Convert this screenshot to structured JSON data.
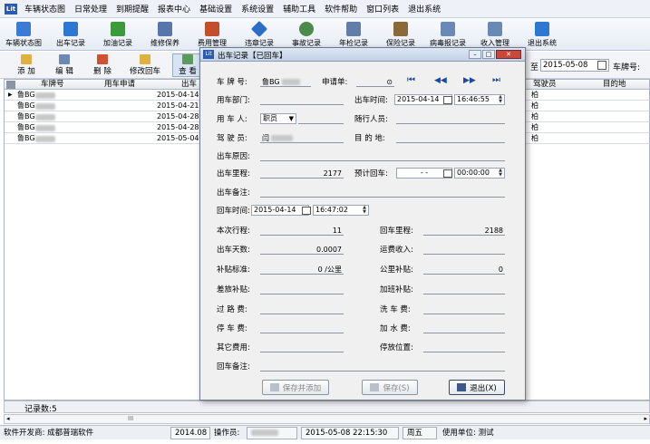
{
  "menubar": {
    "logo": "Lit",
    "items": [
      "车辆状态图",
      "日常处理",
      "到期提醒",
      "报表中心",
      "基础设置",
      "系统设置",
      "辅助工具",
      "软件帮助",
      "窗口列表",
      "退出系统"
    ]
  },
  "toolbar": {
    "buttons": [
      {
        "label": "车辆状态图",
        "icon": "car-status-icon",
        "color": "#3a7bd5"
      },
      {
        "label": "出车记录",
        "icon": "dispatch-icon",
        "color": "#2f78d2"
      },
      {
        "label": "加油记录",
        "icon": "fuel-icon",
        "color": "#3b9a3b"
      },
      {
        "label": "维修保养",
        "icon": "repair-icon",
        "color": "#5577aa"
      },
      {
        "label": "费用管理",
        "icon": "expense-icon",
        "color": "#c44d2a"
      },
      {
        "label": "违章记录",
        "icon": "violation-icon",
        "color": "#2a6fc4"
      },
      {
        "label": "事故记录",
        "icon": "accident-icon",
        "color": "#4a8a4a"
      },
      {
        "label": "年检记录",
        "icon": "inspection-icon",
        "color": "#5f7ea8"
      },
      {
        "label": "保险记录",
        "icon": "insurance-icon",
        "color": "#8a6a3a"
      },
      {
        "label": "病毒报记录",
        "icon": "report-icon",
        "color": "#6a8ab5"
      },
      {
        "label": "收入管理",
        "icon": "income-icon",
        "color": "#6a8ab5"
      },
      {
        "label": "退出系统",
        "icon": "exit-icon",
        "color": "#2f78d2"
      }
    ]
  },
  "toolbar2": {
    "add": "添 加",
    "edit": "编 辑",
    "delete": "删 除",
    "modify_return": "修改回车",
    "view": "查 看",
    "date_prefix": "至",
    "date_value": "2015-05-08",
    "plate_label": "车牌号:"
  },
  "grid": {
    "headers": {
      "plate": "车牌号",
      "request": "用车申请",
      "dispatch": "出车",
      "driver": "驾驶员",
      "destination": "目的地"
    },
    "rows": [
      {
        "plate": "鲁BG",
        "date": "2015-04-14",
        "driver": "柏"
      },
      {
        "plate": "鲁BG",
        "date": "2015-04-21",
        "driver": "柏"
      },
      {
        "plate": "鲁BG",
        "date": "2015-04-28",
        "driver": "柏"
      },
      {
        "plate": "鲁BG",
        "date": "2015-04-28",
        "driver": "柏"
      },
      {
        "plate": "鲁BG",
        "date": "2015-05-04",
        "driver": "柏"
      }
    ],
    "record_count": "记录数:5",
    "scroll_mark": "III"
  },
  "dialog": {
    "title": "出车记录【已回车】",
    "plate_label": "车 牌 号:",
    "plate_value": "鲁BG",
    "request_label": "申请单:",
    "nav_first": "⏮",
    "nav_prev": "◀◀",
    "nav_next": "▶▶",
    "nav_last": "⏭",
    "dept_label": "用车部门:",
    "dispatch_time_label": "出车时间:",
    "dispatch_date": "2015-04-14",
    "dispatch_time": "16:46:55",
    "user_label": "用 车 人:",
    "user_value": "职员",
    "companion_label": "随行人员:",
    "driver_label": "驾 驶 员:",
    "driver_value": "闫",
    "destination_label": "目 的 地:",
    "reason_label": "出车原因:",
    "mileage_label": "出车里程:",
    "mileage_value": "2177",
    "expected_return_label": "预计回车:",
    "expected_return_date": "- -",
    "expected_return_time": "00:00:00",
    "remark_label": "出车备注:",
    "return_time_label": "回车时间:",
    "return_date": "2015-04-14",
    "return_time": "16:47:02",
    "trip_label": "本次行程:",
    "trip_value": "11",
    "return_mileage_label": "回车里程:",
    "return_mileage_value": "2188",
    "days_label": "出车天数:",
    "days_value": "0.0007",
    "freight_label": "运费收入:",
    "subsidy_std_label": "补贴标准:",
    "subsidy_std_value": "0 /公里",
    "km_subsidy_label": "公里补贴:",
    "km_subsidy_value": "0",
    "travel_subsidy_label": "差旅补贴:",
    "overtime_subsidy_label": "加班补贴:",
    "toll_label": "过 路 费:",
    "wash_label": "洗 车 费:",
    "parking_label": "停 车 费:",
    "water_label": "加 水 费:",
    "other_label": "其它费用:",
    "park_pos_label": "停放位置:",
    "return_remark_label": "回车备注:",
    "save_add": "保存并添加",
    "save": "保存(S)",
    "exit": "退出(X)"
  },
  "status": {
    "developer": "软件开发商: 成都普瑞软件",
    "version": "2014.08",
    "operator_label": "操作员:",
    "datetime": "2015-05-08 22:15:30",
    "weekday": "周五",
    "unit": "使用单位: 测试"
  }
}
